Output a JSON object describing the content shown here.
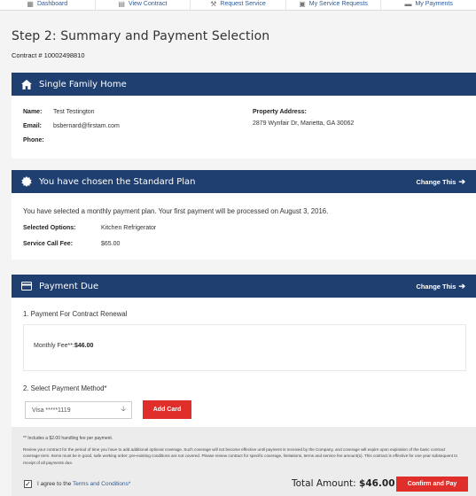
{
  "nav": {
    "items": [
      {
        "label": "Dashboard",
        "icon": "dashboard-icon"
      },
      {
        "label": "View Contract",
        "icon": "document-icon"
      },
      {
        "label": "Request Service",
        "icon": "wrench-icon"
      },
      {
        "label": "My Service Requests",
        "icon": "clipboard-icon"
      },
      {
        "label": "My Payments",
        "icon": "card-icon"
      }
    ]
  },
  "page": {
    "title": "Step 2: Summary and Payment Selection",
    "contract_number": "Contract # 10002498810"
  },
  "home_panel": {
    "title": "Single Family Home",
    "name_label": "Name:",
    "name_value": "Test Testington",
    "email_label": "Email:",
    "email_value": "bsbernard@firstam.com",
    "phone_label": "Phone:",
    "phone_value": "",
    "address_label": "Property Address:",
    "address_value": "2879 Wynfair Dr, Marietta, GA 30062"
  },
  "plan_panel": {
    "title": "You have chosen the Standard Plan",
    "change_label": "Change This",
    "message": "You have selected a monthly payment plan. Your first payment will be processed on August 3, 2016.",
    "options_label": "Selected Options:",
    "options_value": "Kitchen Refrigerator",
    "fee_label": "Service Call Fee:",
    "fee_value": "$65.00"
  },
  "payment_panel": {
    "title": "Payment Due",
    "change_label": "Change This",
    "section1": "1. Payment For Contract Renewal",
    "monthly_fee_label": "Monthly Fee**:",
    "monthly_fee_value": "$46.00",
    "section2": "2. Select Payment Method*",
    "method_selected": "Visa *****1119",
    "add_card_label": "Add Card",
    "handling_note": "** Includes a $2.00 handling fee per payment.",
    "terms_text": "Review your contract for the period of time you have to add additional optional coverage. Such coverage will not become effective until payment is received by the Company, and coverage will expire upon expiration of the basic contract coverage term. Items must be in good, safe working order; pre-existing conditions are not covered. Please review contract for specific coverage, limitations, terms and service fee amount(s). This contract is effective for one year subsequent to receipt of all payments due.",
    "agree_prefix": "I agree to the",
    "agree_link": "Terms and Conditions*",
    "checkbox_checked": true,
    "total_label": "Total Amount:",
    "total_value": "$46.00",
    "confirm_label": "Confirm and Pay"
  },
  "colors": {
    "header_bg": "#1e3f70",
    "accent_red": "#e02f2a",
    "link_blue": "#2d5c9a"
  }
}
